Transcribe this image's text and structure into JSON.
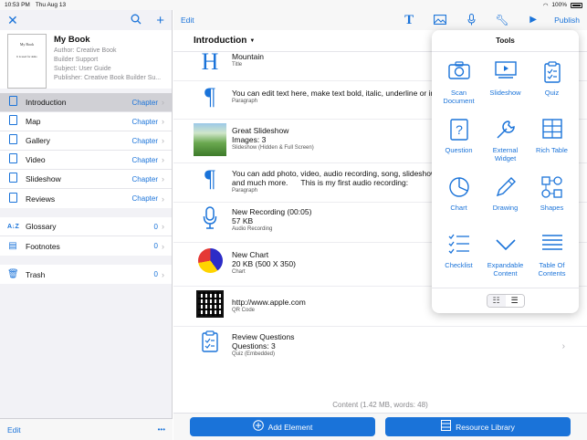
{
  "status": {
    "time": "10:53 PM",
    "date": "Thu Aug 13",
    "battery": "100%"
  },
  "left": {
    "toolbar": {
      "close_icon": "close-icon",
      "search_icon": "search-icon",
      "add_icon": "plus-icon"
    },
    "book": {
      "title": "My Book",
      "cover_title": "My Book",
      "cover_subtitle": "It is used for demo",
      "author": "Author: Creative Book",
      "support": "Builder Support",
      "subject": "Subject: User Guide",
      "publisher": "Publisher: Creative Book Builder Su..."
    },
    "chapters": [
      {
        "label": "Introduction",
        "value": "Chapter"
      },
      {
        "label": "Map",
        "value": "Chapter"
      },
      {
        "label": "Gallery",
        "value": "Chapter"
      },
      {
        "label": "Video",
        "value": "Chapter"
      },
      {
        "label": "Slideshow",
        "value": "Chapter"
      },
      {
        "label": "Reviews",
        "value": "Chapter"
      }
    ],
    "extras": [
      {
        "label": "Glossary",
        "value": "0"
      },
      {
        "label": "Footnotes",
        "value": "0"
      }
    ],
    "trash": {
      "label": "Trash",
      "value": "0"
    },
    "bottom": {
      "edit": "Edit",
      "more": "•••"
    }
  },
  "right": {
    "toolbar": {
      "edit": "Edit",
      "publish": "Publish"
    },
    "chapter_title": "Introduction",
    "items": [
      {
        "title": "Mountain",
        "subtitle": "Title"
      },
      {
        "title": "You can edit text here, make text bold, italic, underline or insert li",
        "subtitle": "Paragraph"
      },
      {
        "title": "Great Slideshow",
        "line2": "Images: 3",
        "subtitle": "Slideshow (Hidden & Full Screen)"
      },
      {
        "title": "You can add photo, video, audio recording, song, slideshow, quiz",
        "line2": "and much more.      This is my first audio recording:",
        "subtitle": "Paragraph"
      },
      {
        "title": "New Recording (00:05)",
        "line2": "57 KB",
        "subtitle": "Audio Recording"
      },
      {
        "title": "New Chart",
        "line2": "20 KB (500 X 350)",
        "subtitle": "Chart"
      },
      {
        "title": "http://www.apple.com",
        "subtitle": "QR Code"
      },
      {
        "title": "Review Questions",
        "line2": "Questions: 3",
        "subtitle": "Quiz (Embedded)"
      }
    ],
    "content_summary": "Content (1.42 MB, words: 48)",
    "footer": {
      "add_element": "Add Element",
      "resource_library": "Resource Library"
    }
  },
  "tools": {
    "title": "Tools",
    "items": [
      {
        "label": "Scan Document",
        "icon": "camera-icon"
      },
      {
        "label": "Slideshow",
        "icon": "slideshow-icon"
      },
      {
        "label": "Quiz",
        "icon": "quiz-icon"
      },
      {
        "label": "Question",
        "icon": "question-icon"
      },
      {
        "label": "External Widget",
        "icon": "wrench-icon"
      },
      {
        "label": "Rich Table",
        "icon": "table-icon"
      },
      {
        "label": "Chart",
        "icon": "pie-chart-icon"
      },
      {
        "label": "Drawing",
        "icon": "pen-icon"
      },
      {
        "label": "Shapes",
        "icon": "shapes-icon"
      },
      {
        "label": "Checklist",
        "icon": "checklist-icon"
      },
      {
        "label": "Expandable Content",
        "icon": "chevron-down-icon"
      },
      {
        "label": "Table Of Contents",
        "icon": "list-icon"
      }
    ]
  },
  "colors": {
    "accent": "#1a73d9",
    "selected_row": "#d0d0d5"
  }
}
